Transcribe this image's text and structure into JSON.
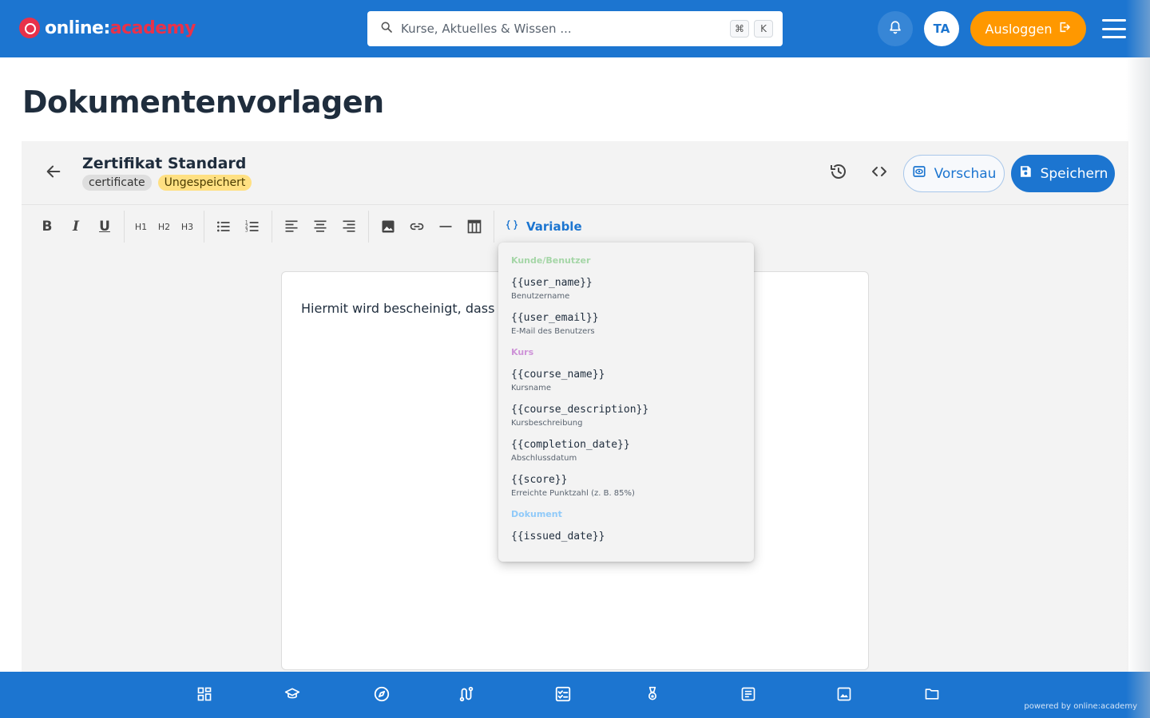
{
  "app": {
    "logo_part1": "online:",
    "logo_part2": "academy",
    "powered_by": "powered by online:academy"
  },
  "header": {
    "search_placeholder": "Kurse, Aktuelles & Wissen ...",
    "shortcut_key1": "⌘",
    "shortcut_key2": "K",
    "avatar_initials": "TA",
    "logout_label": "Ausloggen"
  },
  "page": {
    "title": "Dokumentenvorlagen"
  },
  "editor": {
    "doc_title": "Zertifikat Standard",
    "tag_type": "certificate",
    "tag_status": "Ungespeichert",
    "preview_label": "Vorschau",
    "save_label": "Speichern",
    "toolbar": {
      "bold": "B",
      "italic": "I",
      "underline": "U",
      "h1": "H1",
      "h2": "H2",
      "h3": "H3",
      "variable_label": "Variable"
    },
    "content_text": "Hiermit wird bescheinigt, dass"
  },
  "variables_dropdown": {
    "groups": [
      {
        "category": "Kunde/Benutzer",
        "color": "#a5d6a7",
        "items": [
          {
            "code": "{{user_name}}",
            "desc": "Benutzername"
          },
          {
            "code": "{{user_email}}",
            "desc": "E-Mail des Benutzers"
          }
        ]
      },
      {
        "category": "Kurs",
        "color": "#ce93d8",
        "items": [
          {
            "code": "{{course_name}}",
            "desc": "Kursname"
          },
          {
            "code": "{{course_description}}",
            "desc": "Kursbeschreibung"
          },
          {
            "code": "{{completion_date}}",
            "desc": "Abschlussdatum"
          },
          {
            "code": "{{score}}",
            "desc": "Erreichte Punktzahl (z. B. 85%)"
          }
        ]
      },
      {
        "category": "Dokument",
        "color": "#90caf9",
        "items": [
          {
            "code": "{{issued_date}}",
            "desc": ""
          }
        ]
      }
    ]
  },
  "bottom_nav": {
    "icons": [
      "dashboard-icon",
      "graduation-cap-icon",
      "compass-icon",
      "route-icon",
      "checklist-icon",
      "medal-icon",
      "article-icon",
      "image-icon",
      "folder-icon"
    ]
  },
  "colors": {
    "primary": "#1c75d0",
    "accent_orange": "#ff9800",
    "brand_red": "#e8324a",
    "unsaved_tag": "#ffe082"
  }
}
